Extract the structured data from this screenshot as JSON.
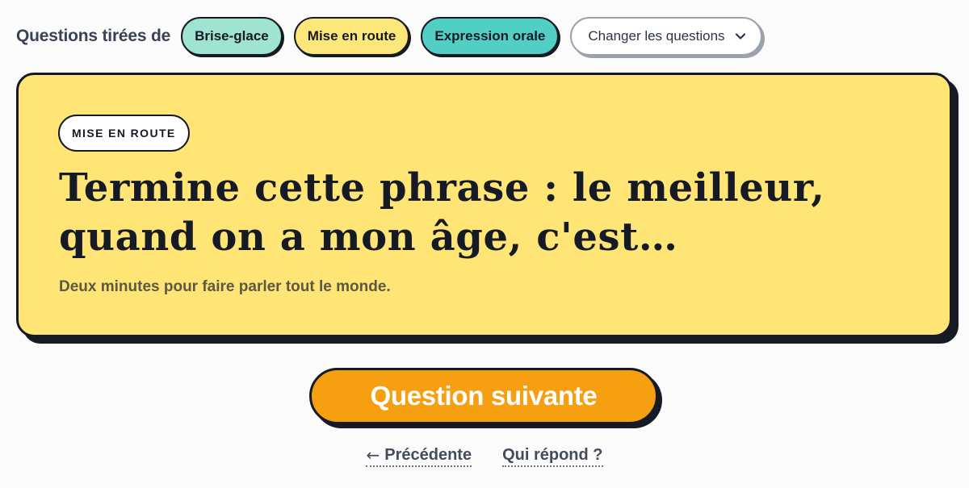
{
  "filters": {
    "label": "Questions tirées de",
    "chips": [
      {
        "label": "Brise-glace",
        "color": "#9fe3d1"
      },
      {
        "label": "Mise en route",
        "color": "#fde77a"
      },
      {
        "label": "Expression orale",
        "color": "#52cfc4"
      }
    ],
    "change_label": "Changer les questions",
    "change_icon": "chevron-down-icon"
  },
  "card": {
    "background": "#fee576",
    "tag": "MISE EN ROUTE",
    "question": "Termine cette phrase : le meilleur, quand on a mon âge, c'est…",
    "subtitle": "Deux minutes pour faire parler tout le monde."
  },
  "actions": {
    "next_label": "Question suivante",
    "next_color": "#f59f11",
    "previous_label": "Précédente",
    "previous_icon": "arrow-left-icon",
    "who_answers_label": "Qui répond ?"
  }
}
